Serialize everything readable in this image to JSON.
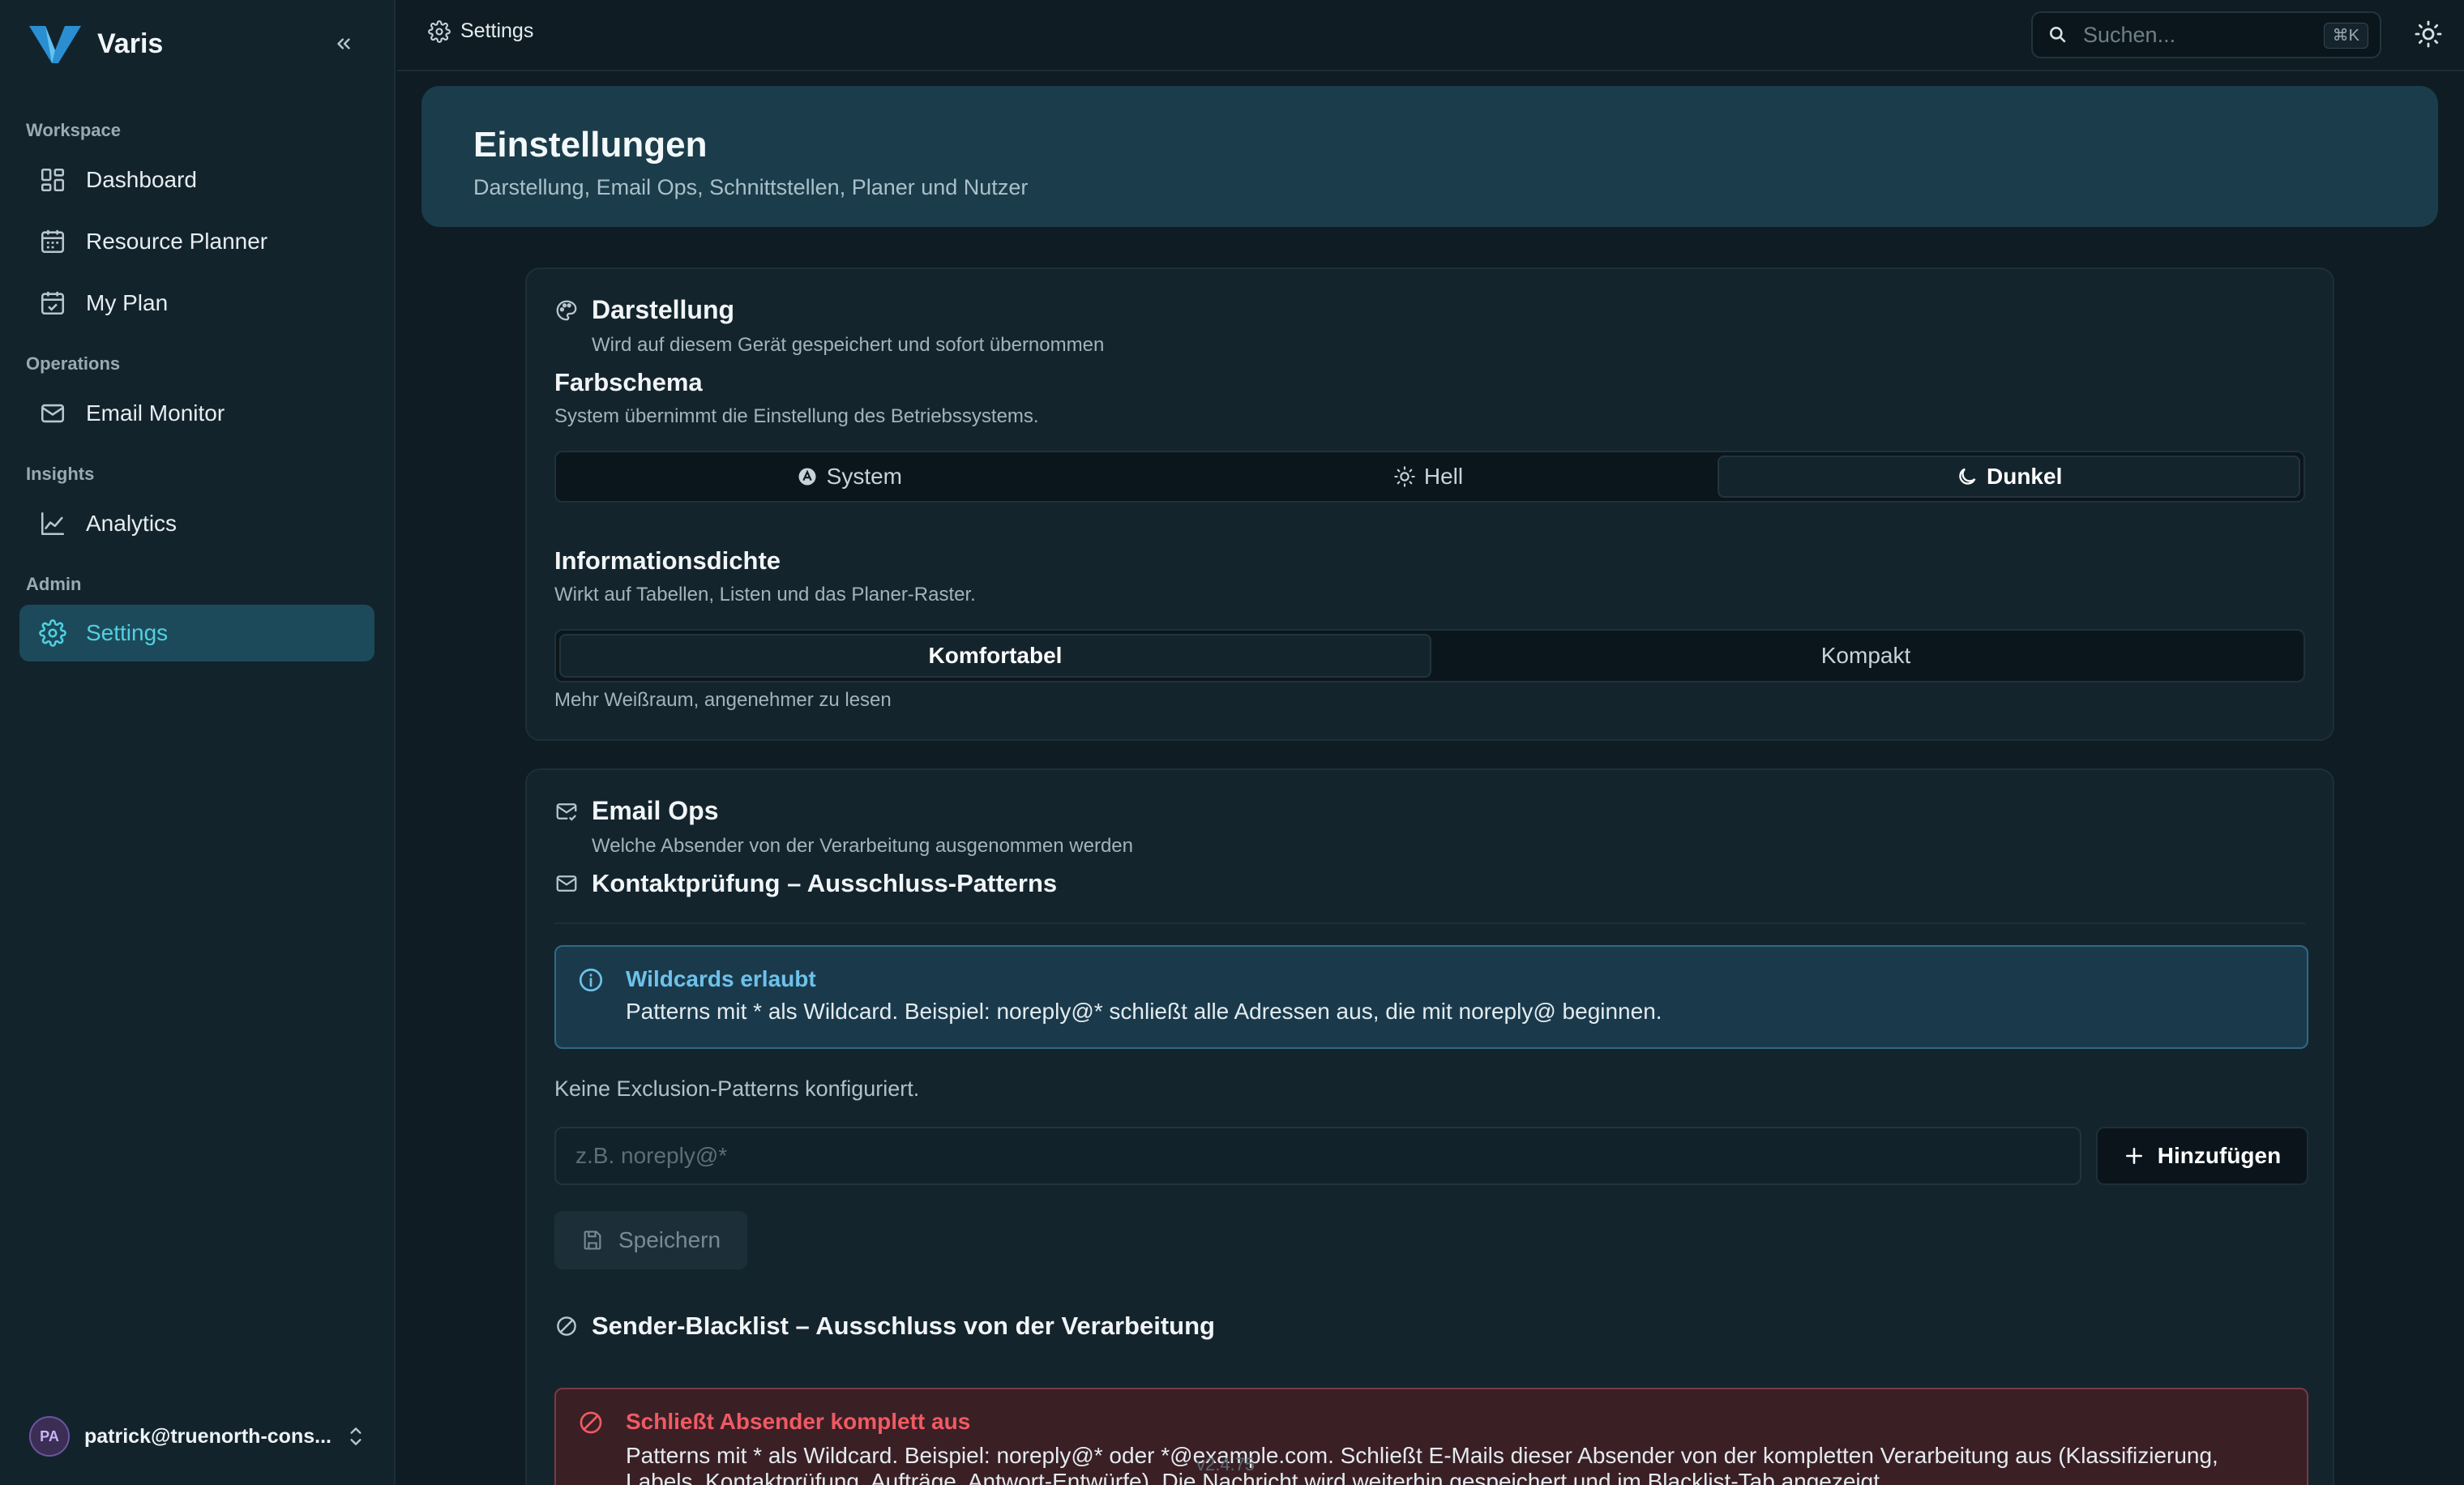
{
  "app": {
    "name": "Varis"
  },
  "sidebar": {
    "sections": [
      {
        "label": "Workspace"
      },
      {
        "label": "Operations"
      },
      {
        "label": "Insights"
      },
      {
        "label": "Admin"
      }
    ],
    "items": [
      {
        "label": "Dashboard",
        "icon": "dashboard-icon"
      },
      {
        "label": "Resource Planner",
        "icon": "calendar-icon"
      },
      {
        "label": "My Plan",
        "icon": "calendar-check-icon"
      },
      {
        "label": "Email Monitor",
        "icon": "mail-icon"
      },
      {
        "label": "Analytics",
        "icon": "chart-line-icon"
      },
      {
        "label": "Settings",
        "icon": "gear-icon",
        "active": true
      }
    ],
    "user": {
      "initials": "PA",
      "email": "patrick@truenorth-cons..."
    }
  },
  "topbar": {
    "breadcrumb": "Settings",
    "search": {
      "placeholder": "Suchen...",
      "shortcut": "⌘K"
    }
  },
  "header": {
    "title": "Einstellungen",
    "subtitle": "Darstellung, Email Ops, Schnittstellen, Planer und Nutzer"
  },
  "darstellung": {
    "title": "Darstellung",
    "description": "Wird auf diesem Gerät gespeichert und sofort übernommen",
    "farbschema": {
      "title": "Farbschema",
      "description": "System übernimmt die Einstellung des Betriebssystems.",
      "options": [
        "System",
        "Hell",
        "Dunkel"
      ],
      "selected": "Dunkel"
    },
    "dichte": {
      "title": "Informationsdichte",
      "description": "Wirkt auf Tabellen, Listen und das Planer-Raster.",
      "options": [
        "Komfortabel",
        "Kompakt"
      ],
      "selected": "Komfortabel",
      "hint": "Mehr Weißraum, angenehmer zu lesen"
    }
  },
  "email_ops": {
    "title": "Email Ops",
    "description": "Welche Absender von der Verarbeitung ausgenommen werden",
    "kontakt": {
      "title": "Kontaktprüfung – Ausschluss-Patterns",
      "info_title": "Wildcards erlaubt",
      "info_text": "Patterns mit * als Wildcard. Beispiel: noreply@* schließt alle Adressen aus, die mit noreply@ beginnen.",
      "empty_text": "Keine Exclusion-Patterns konfiguriert.",
      "input_placeholder": "z.B. noreply@*",
      "add_label": "Hinzufügen",
      "save_label": "Speichern"
    },
    "blacklist": {
      "title": "Sender-Blacklist – Ausschluss von der Verarbeitung",
      "alert_title": "Schließt Absender komplett aus",
      "alert_text": "Patterns mit * als Wildcard. Beispiel: noreply@* oder *@example.com. Schließt E-Mails dieser Absender von der kompletten Verarbeitung aus (Klassifizierung, Labels, Kontaktprüfung, Aufträge, Antwort-Entwürfe). Die Nachricht wird weiterhin gespeichert und im Blacklist-Tab angezeigt."
    }
  },
  "footer": {
    "version": "v2.4.75"
  },
  "colors": {
    "accent": "#4fd1e0",
    "info": "#6ec1ea",
    "danger": "#f05a62"
  }
}
